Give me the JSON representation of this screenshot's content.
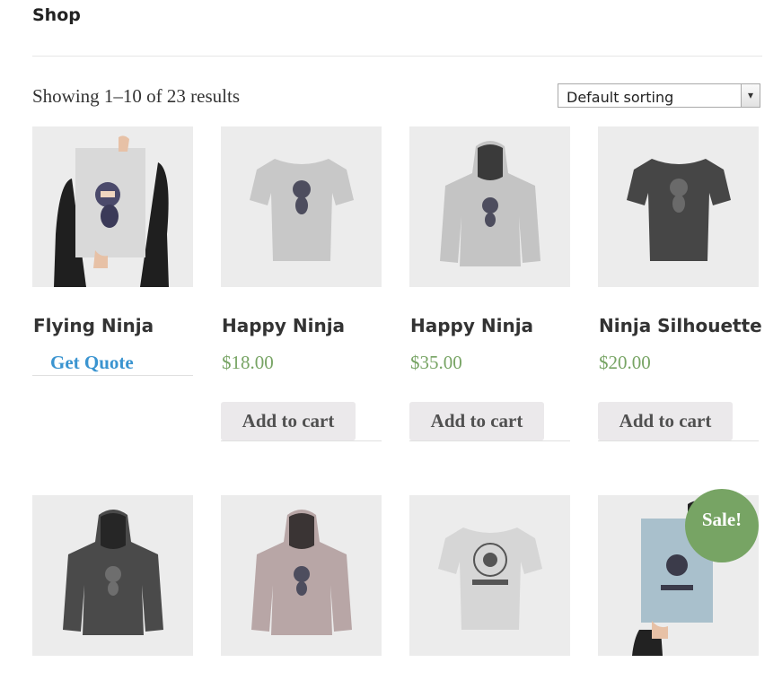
{
  "header": {
    "breadcrumb": "Shop"
  },
  "toolbar": {
    "result_count": "Showing 1–10 of 23 results",
    "sort_selected": "Default sorting"
  },
  "products": [
    {
      "name": "Flying Ninja",
      "price": "",
      "action": "Get Quote",
      "image": "ninja-poster-held"
    },
    {
      "name": "Happy Ninja",
      "price": "$18.00",
      "action": "Add to cart",
      "image": "light-gray-tshirt"
    },
    {
      "name": "Happy Ninja",
      "price": "$35.00",
      "action": "Add to cart",
      "image": "light-gray-hoodie"
    },
    {
      "name": "Ninja Silhouette",
      "price": "$20.00",
      "action": "Add to cart",
      "image": "dark-gray-tshirt"
    },
    {
      "image": "dark-gray-hoodie"
    },
    {
      "image": "mauve-hoodie"
    },
    {
      "image": "woothemes-tshirt"
    },
    {
      "image": "woothemes-poster-held",
      "badge": "Sale!"
    }
  ],
  "colors": {
    "price": "#77a464",
    "sale_badge": "#77a464",
    "quote_link": "#3a94d0",
    "button_bg": "#ebe9eb"
  }
}
